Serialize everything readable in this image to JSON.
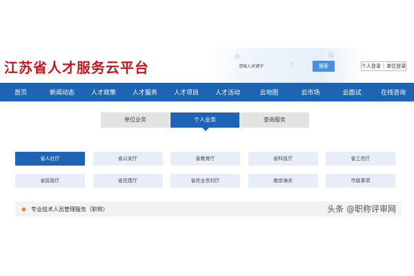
{
  "header": {
    "site_title": "江苏省人才服务云平台",
    "search_placeholder": "请输入关键字",
    "search_button": "搜索",
    "login_person": "个人登录",
    "login_separator": "|",
    "login_unit": "单位登录"
  },
  "nav": {
    "items": [
      "首页",
      "新闻动态",
      "人才政策",
      "人才服务",
      "人才项目",
      "人才活动",
      "云地图",
      "云市场",
      "云面试",
      "在线咨询"
    ]
  },
  "tabs": {
    "items": [
      "单位业务",
      "个人业务",
      "查询服务"
    ],
    "active": "个人业务"
  },
  "departments": {
    "items": [
      "省人社厅",
      "省公安厅",
      "省教育厅",
      "省科技厅",
      "省工信厅",
      "省民政厅",
      "省住建厅",
      "省农业农村厅",
      "南京海关",
      "市级事项"
    ],
    "active": "省人社厅"
  },
  "service": {
    "label": "专业技术人员管理服务（职称）"
  },
  "watermark": {
    "text": "头条 @职称评审网"
  },
  "colors": {
    "brand_red": "#c4161c",
    "nav_blue": "#1e64b4",
    "accent_orange": "#e8822a"
  }
}
